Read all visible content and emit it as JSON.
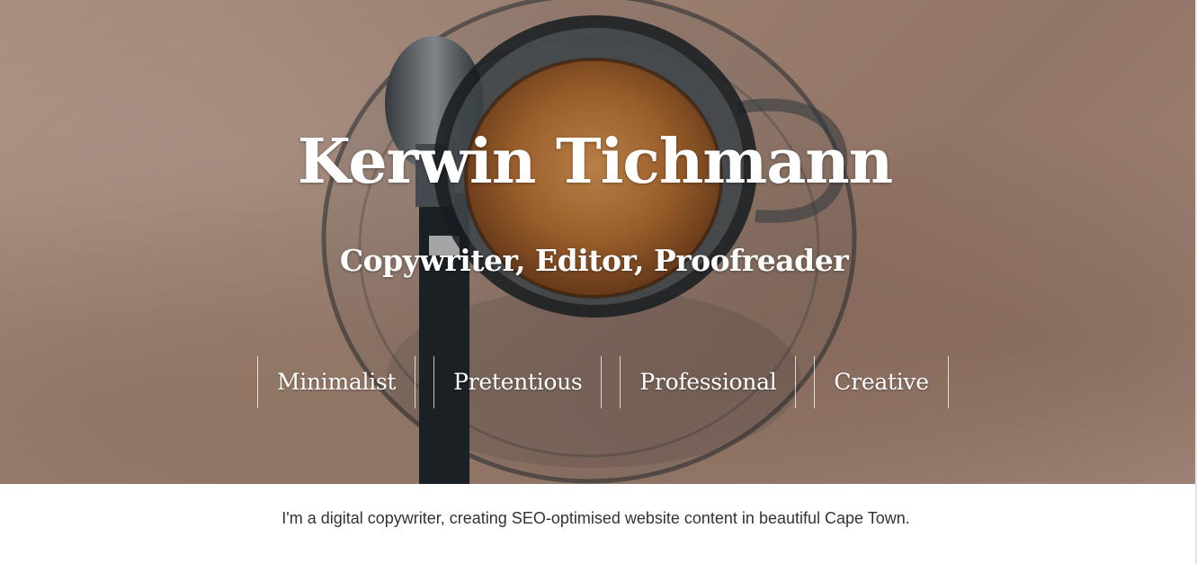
{
  "hero": {
    "title": "Kerwin Tichmann",
    "tagline": "Copywriter, Editor, Proofreader"
  },
  "style_nav": {
    "items": [
      {
        "label": "Minimalist"
      },
      {
        "label": "Pretentious"
      },
      {
        "label": "Professional"
      },
      {
        "label": "Creative"
      }
    ]
  },
  "intro": {
    "text": "I'm a digital copywriter, creating SEO-optimised website content in beautiful Cape Town."
  }
}
